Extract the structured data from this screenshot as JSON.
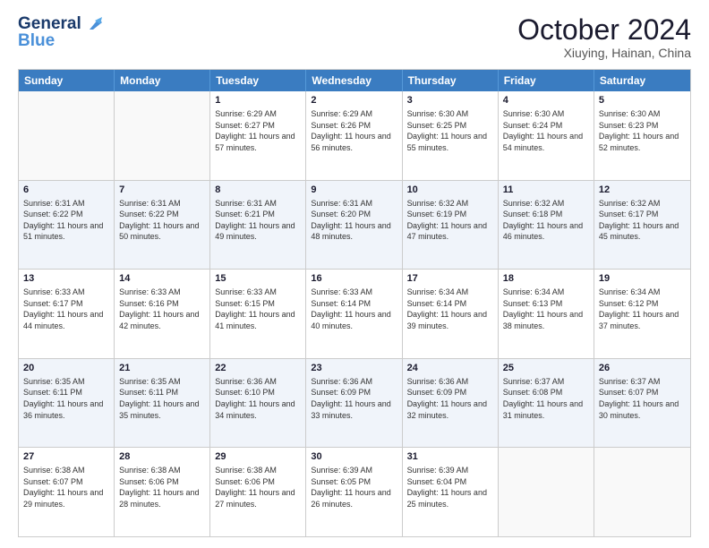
{
  "header": {
    "logo_line1": "General",
    "logo_line2": "Blue",
    "month": "October 2024",
    "location": "Xiuying, Hainan, China"
  },
  "days_of_week": [
    "Sunday",
    "Monday",
    "Tuesday",
    "Wednesday",
    "Thursday",
    "Friday",
    "Saturday"
  ],
  "weeks": [
    [
      {
        "day": "",
        "sunrise": "",
        "sunset": "",
        "daylight": ""
      },
      {
        "day": "",
        "sunrise": "",
        "sunset": "",
        "daylight": ""
      },
      {
        "day": "1",
        "sunrise": "Sunrise: 6:29 AM",
        "sunset": "Sunset: 6:27 PM",
        "daylight": "Daylight: 11 hours and 57 minutes."
      },
      {
        "day": "2",
        "sunrise": "Sunrise: 6:29 AM",
        "sunset": "Sunset: 6:26 PM",
        "daylight": "Daylight: 11 hours and 56 minutes."
      },
      {
        "day": "3",
        "sunrise": "Sunrise: 6:30 AM",
        "sunset": "Sunset: 6:25 PM",
        "daylight": "Daylight: 11 hours and 55 minutes."
      },
      {
        "day": "4",
        "sunrise": "Sunrise: 6:30 AM",
        "sunset": "Sunset: 6:24 PM",
        "daylight": "Daylight: 11 hours and 54 minutes."
      },
      {
        "day": "5",
        "sunrise": "Sunrise: 6:30 AM",
        "sunset": "Sunset: 6:23 PM",
        "daylight": "Daylight: 11 hours and 52 minutes."
      }
    ],
    [
      {
        "day": "6",
        "sunrise": "Sunrise: 6:31 AM",
        "sunset": "Sunset: 6:22 PM",
        "daylight": "Daylight: 11 hours and 51 minutes."
      },
      {
        "day": "7",
        "sunrise": "Sunrise: 6:31 AM",
        "sunset": "Sunset: 6:22 PM",
        "daylight": "Daylight: 11 hours and 50 minutes."
      },
      {
        "day": "8",
        "sunrise": "Sunrise: 6:31 AM",
        "sunset": "Sunset: 6:21 PM",
        "daylight": "Daylight: 11 hours and 49 minutes."
      },
      {
        "day": "9",
        "sunrise": "Sunrise: 6:31 AM",
        "sunset": "Sunset: 6:20 PM",
        "daylight": "Daylight: 11 hours and 48 minutes."
      },
      {
        "day": "10",
        "sunrise": "Sunrise: 6:32 AM",
        "sunset": "Sunset: 6:19 PM",
        "daylight": "Daylight: 11 hours and 47 minutes."
      },
      {
        "day": "11",
        "sunrise": "Sunrise: 6:32 AM",
        "sunset": "Sunset: 6:18 PM",
        "daylight": "Daylight: 11 hours and 46 minutes."
      },
      {
        "day": "12",
        "sunrise": "Sunrise: 6:32 AM",
        "sunset": "Sunset: 6:17 PM",
        "daylight": "Daylight: 11 hours and 45 minutes."
      }
    ],
    [
      {
        "day": "13",
        "sunrise": "Sunrise: 6:33 AM",
        "sunset": "Sunset: 6:17 PM",
        "daylight": "Daylight: 11 hours and 44 minutes."
      },
      {
        "day": "14",
        "sunrise": "Sunrise: 6:33 AM",
        "sunset": "Sunset: 6:16 PM",
        "daylight": "Daylight: 11 hours and 42 minutes."
      },
      {
        "day": "15",
        "sunrise": "Sunrise: 6:33 AM",
        "sunset": "Sunset: 6:15 PM",
        "daylight": "Daylight: 11 hours and 41 minutes."
      },
      {
        "day": "16",
        "sunrise": "Sunrise: 6:33 AM",
        "sunset": "Sunset: 6:14 PM",
        "daylight": "Daylight: 11 hours and 40 minutes."
      },
      {
        "day": "17",
        "sunrise": "Sunrise: 6:34 AM",
        "sunset": "Sunset: 6:14 PM",
        "daylight": "Daylight: 11 hours and 39 minutes."
      },
      {
        "day": "18",
        "sunrise": "Sunrise: 6:34 AM",
        "sunset": "Sunset: 6:13 PM",
        "daylight": "Daylight: 11 hours and 38 minutes."
      },
      {
        "day": "19",
        "sunrise": "Sunrise: 6:34 AM",
        "sunset": "Sunset: 6:12 PM",
        "daylight": "Daylight: 11 hours and 37 minutes."
      }
    ],
    [
      {
        "day": "20",
        "sunrise": "Sunrise: 6:35 AM",
        "sunset": "Sunset: 6:11 PM",
        "daylight": "Daylight: 11 hours and 36 minutes."
      },
      {
        "day": "21",
        "sunrise": "Sunrise: 6:35 AM",
        "sunset": "Sunset: 6:11 PM",
        "daylight": "Daylight: 11 hours and 35 minutes."
      },
      {
        "day": "22",
        "sunrise": "Sunrise: 6:36 AM",
        "sunset": "Sunset: 6:10 PM",
        "daylight": "Daylight: 11 hours and 34 minutes."
      },
      {
        "day": "23",
        "sunrise": "Sunrise: 6:36 AM",
        "sunset": "Sunset: 6:09 PM",
        "daylight": "Daylight: 11 hours and 33 minutes."
      },
      {
        "day": "24",
        "sunrise": "Sunrise: 6:36 AM",
        "sunset": "Sunset: 6:09 PM",
        "daylight": "Daylight: 11 hours and 32 minutes."
      },
      {
        "day": "25",
        "sunrise": "Sunrise: 6:37 AM",
        "sunset": "Sunset: 6:08 PM",
        "daylight": "Daylight: 11 hours and 31 minutes."
      },
      {
        "day": "26",
        "sunrise": "Sunrise: 6:37 AM",
        "sunset": "Sunset: 6:07 PM",
        "daylight": "Daylight: 11 hours and 30 minutes."
      }
    ],
    [
      {
        "day": "27",
        "sunrise": "Sunrise: 6:38 AM",
        "sunset": "Sunset: 6:07 PM",
        "daylight": "Daylight: 11 hours and 29 minutes."
      },
      {
        "day": "28",
        "sunrise": "Sunrise: 6:38 AM",
        "sunset": "Sunset: 6:06 PM",
        "daylight": "Daylight: 11 hours and 28 minutes."
      },
      {
        "day": "29",
        "sunrise": "Sunrise: 6:38 AM",
        "sunset": "Sunset: 6:06 PM",
        "daylight": "Daylight: 11 hours and 27 minutes."
      },
      {
        "day": "30",
        "sunrise": "Sunrise: 6:39 AM",
        "sunset": "Sunset: 6:05 PM",
        "daylight": "Daylight: 11 hours and 26 minutes."
      },
      {
        "day": "31",
        "sunrise": "Sunrise: 6:39 AM",
        "sunset": "Sunset: 6:04 PM",
        "daylight": "Daylight: 11 hours and 25 minutes."
      },
      {
        "day": "",
        "sunrise": "",
        "sunset": "",
        "daylight": ""
      },
      {
        "day": "",
        "sunrise": "",
        "sunset": "",
        "daylight": ""
      }
    ]
  ]
}
